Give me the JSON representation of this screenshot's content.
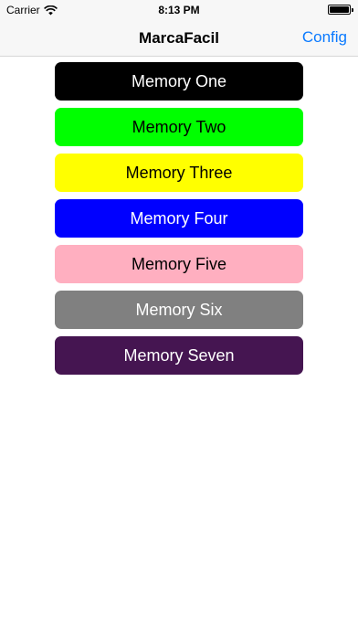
{
  "status_bar": {
    "carrier": "Carrier",
    "time": "8:13 PM"
  },
  "nav_bar": {
    "title": "MarcaFacil",
    "config_label": "Config"
  },
  "memories": [
    {
      "label": "Memory One",
      "background": "#000000",
      "text_color": "#ffffff"
    },
    {
      "label": "Memory Two",
      "background": "#00ff00",
      "text_color": "#000000"
    },
    {
      "label": "Memory Three",
      "background": "#ffff00",
      "text_color": "#000000"
    },
    {
      "label": "Memory Four",
      "background": "#0000ff",
      "text_color": "#ffffff"
    },
    {
      "label": "Memory Five",
      "background": "#ffafc0",
      "text_color": "#000000"
    },
    {
      "label": "Memory Six",
      "background": "#808080",
      "text_color": "#ffffff"
    },
    {
      "label": "Memory Seven",
      "background": "#451551",
      "text_color": "#ffffff"
    }
  ]
}
